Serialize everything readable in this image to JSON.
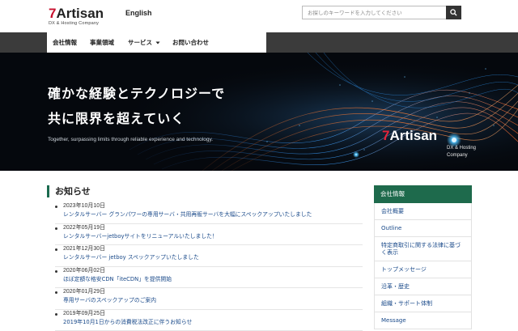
{
  "header": {
    "logo_mark": "7",
    "logo_name": "Artisan",
    "logo_sub": "DX & Hosting Company",
    "lang_link": "English",
    "search_placeholder": "お探しのキーワードを入力してください",
    "search_icon": "search-icon"
  },
  "nav": {
    "items": [
      {
        "label": "会社情報"
      },
      {
        "label": "事業領域"
      },
      {
        "label": "サービス"
      },
      {
        "label": "お問い合わせ"
      }
    ],
    "dropdown_icon": "caret-down-icon"
  },
  "hero": {
    "line1": "確かな経験とテクノロジーで",
    "line2": "共に限界を超えていく",
    "english": "Together, surpassing limits through reliable experience and technology.",
    "logo_mark": "7",
    "logo_name": "Artisan",
    "logo_sub1": "DX & Hosting",
    "logo_sub2": "Company"
  },
  "news": {
    "title": "お知らせ",
    "items": [
      {
        "date": "2023年10月10日",
        "text": "レンタルサーバー グランパワーの専用サーバ・共用再販サーバを大幅にスペックアップいたしました"
      },
      {
        "date": "2022年05月19日",
        "text": "レンタルサーバーjetboyサイトをリニューアルいたしました！"
      },
      {
        "date": "2021年12月30日",
        "text": "レンタルサーバー jetboy スペックアップいたしました"
      },
      {
        "date": "2020年06月02日",
        "text": "ほぼ定額な格安CDN「iteCDN」を提供開始"
      },
      {
        "date": "2020年01月29日",
        "text": "専用サーバのスペックアップのご案内"
      },
      {
        "date": "2019年09月25日",
        "text": "2019年10月1日からの消費税法改正に伴うお知らせ"
      }
    ]
  },
  "sidebar": {
    "heading": "会社情報",
    "items": [
      {
        "label": "会社概要"
      },
      {
        "label": "Outline"
      },
      {
        "label": "特定商取引に関する法律に基づく表示"
      },
      {
        "label": "トップメッセージ"
      },
      {
        "label": "沿革・歴史"
      },
      {
        "label": "組織・サポート体制"
      },
      {
        "label": "Message"
      }
    ]
  },
  "colors": {
    "accent_green": "#1e6a4c",
    "logo_red": "#c8102e",
    "nav_dark": "#3b3b3b",
    "link_blue": "#1a4a8a"
  }
}
